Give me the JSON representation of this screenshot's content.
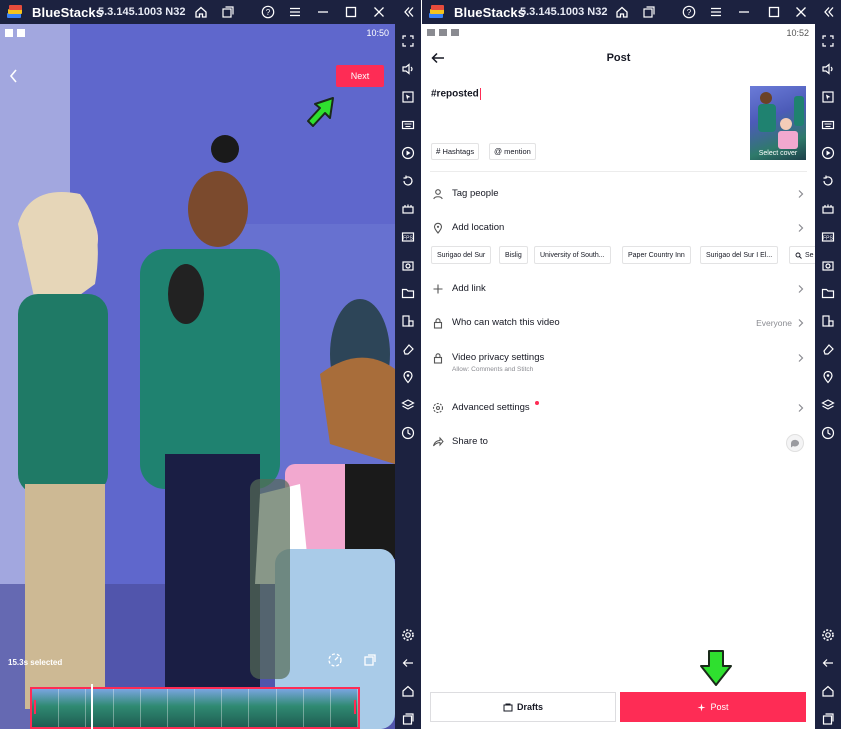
{
  "app": {
    "title": "BlueStacks",
    "version": "5.3.145.1003 N32"
  },
  "left_screen": {
    "time": "10:50",
    "next_label": "Next",
    "selected_text": "15.3s selected",
    "filmstrip_frames": 12
  },
  "right_screen": {
    "time": "10:52",
    "header_title": "Post",
    "caption_text": "#reposted",
    "cover_label": "Select cover",
    "chips": {
      "hashtags": "Hashtags",
      "mention": "mention"
    },
    "rows": {
      "tag_people": "Tag people",
      "add_location": "Add location",
      "add_link": "Add link",
      "who_can_watch": "Who can watch this video",
      "who_can_watch_value": "Everyone",
      "privacy": "Video privacy settings",
      "privacy_sub": "Allow: Comments and Stitch",
      "advanced": "Advanced settings",
      "share_to": "Share to"
    },
    "locations": [
      "Surigao del Sur",
      "Bislig",
      "University of South...",
      "Paper Country Inn",
      "Surigao del Sur I El...",
      "Se"
    ],
    "drafts_label": "Drafts",
    "post_label": "Post"
  },
  "colors": {
    "accent": "#fe2c55",
    "chrome": "#1c2240",
    "pointer_arrow": "#2fe02f"
  }
}
